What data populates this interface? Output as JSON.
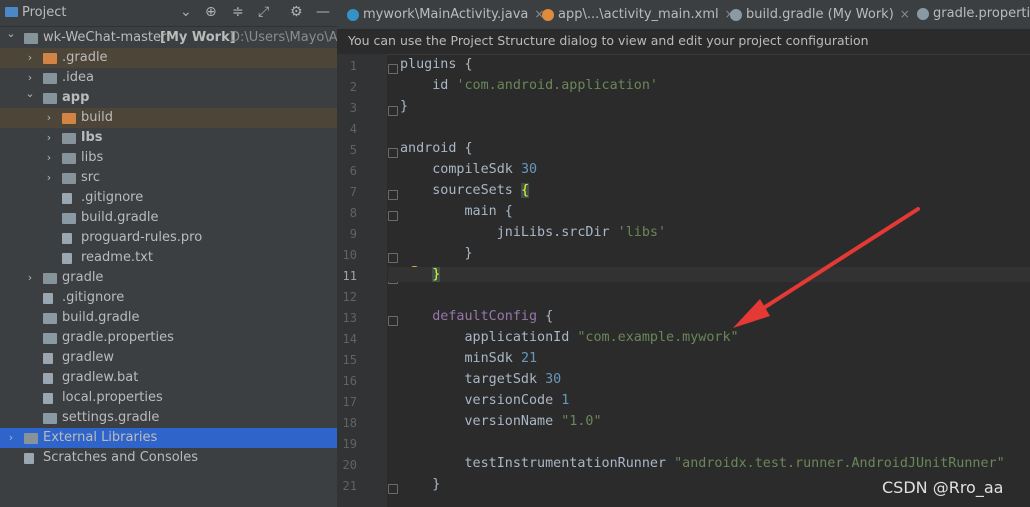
{
  "panel": {
    "title": "Project",
    "icons": [
      "chevron-down-icon",
      "locate-icon",
      "collapse-all-icon",
      "expand-icon",
      "gear-icon",
      "minimize-icon"
    ]
  },
  "tree": [
    {
      "label": "wk-WeChat-master",
      "bold_suffix": "[My Work]",
      "path": "D:\\Users\\Mayo\\An",
      "indent": 0,
      "arrow": "down",
      "icon": "module",
      "sel": ""
    },
    {
      "label": ".gradle",
      "indent": 1,
      "arrow": "right",
      "icon": "folder-orange",
      "sel": "brown"
    },
    {
      "label": ".idea",
      "indent": 1,
      "arrow": "right",
      "icon": "folder",
      "sel": ""
    },
    {
      "label": "app",
      "indent": 1,
      "arrow": "down",
      "icon": "module",
      "sel": "",
      "bold": true
    },
    {
      "label": "build",
      "indent": 2,
      "arrow": "right",
      "icon": "folder-orange",
      "sel": "brown"
    },
    {
      "label": "lbs",
      "indent": 2,
      "arrow": "right",
      "icon": "module",
      "sel": "",
      "bold": true
    },
    {
      "label": "libs",
      "indent": 2,
      "arrow": "right",
      "icon": "folder",
      "sel": ""
    },
    {
      "label": "src",
      "indent": 2,
      "arrow": "right",
      "icon": "folder",
      "sel": ""
    },
    {
      "label": ".gitignore",
      "indent": 2,
      "arrow": "",
      "icon": "file",
      "sel": ""
    },
    {
      "label": "build.gradle",
      "indent": 2,
      "arrow": "",
      "icon": "gradle",
      "sel": ""
    },
    {
      "label": "proguard-rules.pro",
      "indent": 2,
      "arrow": "",
      "icon": "file",
      "sel": ""
    },
    {
      "label": "readme.txt",
      "indent": 2,
      "arrow": "",
      "icon": "file",
      "sel": ""
    },
    {
      "label": "gradle",
      "indent": 1,
      "arrow": "right",
      "icon": "folder",
      "sel": ""
    },
    {
      "label": ".gitignore",
      "indent": 1,
      "arrow": "",
      "icon": "file",
      "sel": ""
    },
    {
      "label": "build.gradle",
      "indent": 1,
      "arrow": "",
      "icon": "gradle",
      "sel": ""
    },
    {
      "label": "gradle.properties",
      "indent": 1,
      "arrow": "",
      "icon": "gradle",
      "sel": ""
    },
    {
      "label": "gradlew",
      "indent": 1,
      "arrow": "",
      "icon": "file",
      "sel": ""
    },
    {
      "label": "gradlew.bat",
      "indent": 1,
      "arrow": "",
      "icon": "file",
      "sel": ""
    },
    {
      "label": "local.properties",
      "indent": 1,
      "arrow": "",
      "icon": "file",
      "sel": ""
    },
    {
      "label": "settings.gradle",
      "indent": 1,
      "arrow": "",
      "icon": "gradle",
      "sel": ""
    },
    {
      "label": "External Libraries",
      "indent": 0,
      "arrow": "right",
      "icon": "library",
      "sel": "blue"
    },
    {
      "label": "Scratches and Consoles",
      "indent": 0,
      "arrow": "",
      "icon": "scratch",
      "sel": ""
    }
  ],
  "tabs": [
    {
      "label": "mywork\\MainActivity.java",
      "icon_color": "#3592c4",
      "closable": true
    },
    {
      "label": "app\\...\\activity_main.xml",
      "icon_color": "#e08a3e",
      "closable": true
    },
    {
      "label": "build.gradle (My Work)",
      "icon_color": "#8a9aa5",
      "closable": true
    },
    {
      "label": "gradle.propertie",
      "icon_color": "#8a9aa5",
      "closable": false
    }
  ],
  "banner": "You can use the Project Structure dialog to view and edit your project configuration",
  "code": {
    "line_numbers": [
      "1",
      "2",
      "3",
      "4",
      "5",
      "6",
      "7",
      "8",
      "9",
      "10",
      "11",
      "12",
      "13",
      "14",
      "15",
      "16",
      "17",
      "18",
      "19",
      "20",
      "21"
    ],
    "active_line": 11,
    "lines": [
      [
        {
          "t": "plugins {",
          "c": ""
        }
      ],
      [
        {
          "t": "    id ",
          "c": ""
        },
        {
          "t": "'com.android.application'",
          "c": "str"
        }
      ],
      [
        {
          "t": "}",
          "c": ""
        }
      ],
      [
        {
          "t": "",
          "c": ""
        }
      ],
      [
        {
          "t": "android {",
          "c": ""
        }
      ],
      [
        {
          "t": "    compileSdk ",
          "c": ""
        },
        {
          "t": "30",
          "c": "num"
        }
      ],
      [
        {
          "t": "    sourceSets ",
          "c": ""
        },
        {
          "t": "{",
          "c": "brace-hl"
        }
      ],
      [
        {
          "t": "        main {",
          "c": ""
        }
      ],
      [
        {
          "t": "            jniLibs.srcDir ",
          "c": ""
        },
        {
          "t": "'libs'",
          "c": "str"
        }
      ],
      [
        {
          "t": "        }",
          "c": ""
        }
      ],
      [
        {
          "t": "    ",
          "c": ""
        },
        {
          "t": "}",
          "c": "brace-hl"
        }
      ],
      [
        {
          "t": "",
          "c": ""
        }
      ],
      [
        {
          "t": "    ",
          "c": ""
        },
        {
          "t": "defaultConfig",
          "c": "kw"
        },
        {
          "t": " {",
          "c": ""
        }
      ],
      [
        {
          "t": "        applicationId ",
          "c": ""
        },
        {
          "t": "\"com.example.mywork\"",
          "c": "str"
        }
      ],
      [
        {
          "t": "        minSdk ",
          "c": ""
        },
        {
          "t": "21",
          "c": "num"
        }
      ],
      [
        {
          "t": "        targetSdk ",
          "c": ""
        },
        {
          "t": "30",
          "c": "num"
        }
      ],
      [
        {
          "t": "        versionCode ",
          "c": ""
        },
        {
          "t": "1",
          "c": "num"
        }
      ],
      [
        {
          "t": "        versionName ",
          "c": ""
        },
        {
          "t": "\"1.0\"",
          "c": "str"
        }
      ],
      [
        {
          "t": "",
          "c": ""
        }
      ],
      [
        {
          "t": "        testInstrumentationRunner ",
          "c": ""
        },
        {
          "t": "\"androidx.test.runner.AndroidJUnitRunner\"",
          "c": "str"
        }
      ],
      [
        {
          "t": "    }",
          "c": ""
        }
      ]
    ]
  },
  "watermark": "CSDN @Rro_aa",
  "colors": {
    "arrow": "#e53935",
    "selection": "#2f65ca"
  }
}
